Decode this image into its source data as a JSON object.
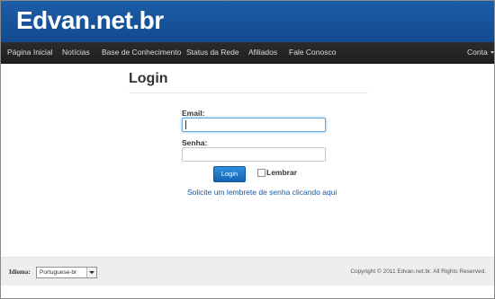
{
  "header": {
    "logo": "Edvan.net.br"
  },
  "nav": {
    "items": [
      {
        "label": "Página Inicial"
      },
      {
        "label": "Notícias"
      },
      {
        "label": "Base de Conhecimento"
      },
      {
        "label": "Status da Rede"
      },
      {
        "label": "Afiliados"
      },
      {
        "label": "Fale Conosco"
      }
    ],
    "account": "Conta"
  },
  "main": {
    "title": "Login",
    "email_label": "Email:",
    "email_value": "",
    "password_label": "Senha:",
    "password_value": "",
    "login_button": "Login",
    "remember_label": "Lembrar",
    "remember_checked": false,
    "reminder_link": "Solicite um lembrete de senha clicando aqui"
  },
  "footer": {
    "language_label": "Idioma:",
    "language_selected": "Portuguese-br",
    "copyright": "Copyright © 2011 Edvan.net.br. All Rights Reserved."
  },
  "colors": {
    "header_bg": "#1a56a0",
    "navbar_bg": "#262626",
    "primary_button": "#1f75c7",
    "link": "#1a58a6"
  },
  "icons": [
    "caret-down-icon",
    "select-arrow-icon",
    "checkbox-icon"
  ]
}
